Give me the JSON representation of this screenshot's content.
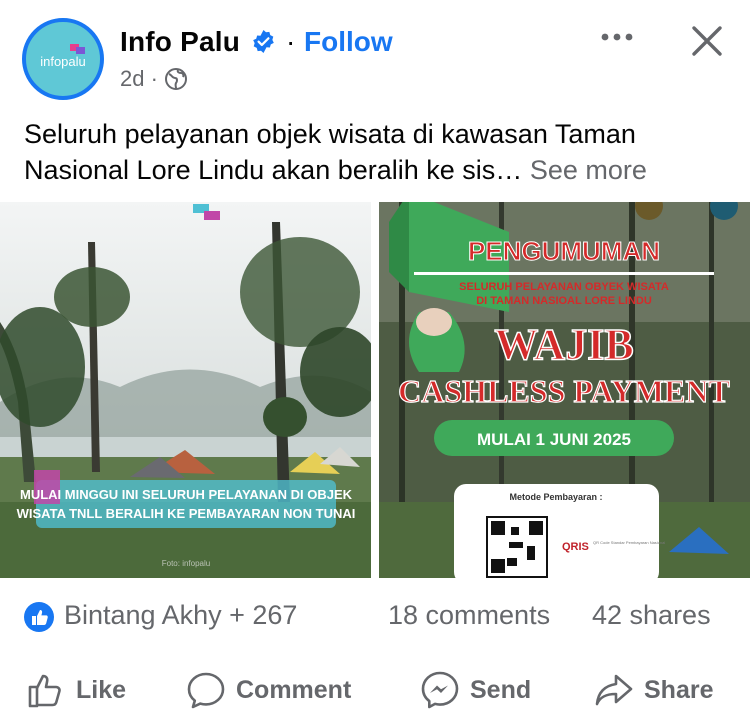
{
  "post": {
    "page_name": "Info Palu",
    "follow_label": "Follow",
    "separator": "·",
    "age": "2d ·",
    "avatar_text": "infopalu",
    "text": "Seluruh pelayanan objek wisata di kawasan Taman Nasional Lore Lindu akan beralih ke sis…",
    "see_more": "See more"
  },
  "photo1": {
    "caption_line1": "MULAI MINGGU INI SELURUH PELAYANAN DI OBJEK",
    "caption_line2": "WISATA TNLL BERALIH KE PEMBAYARAN NON TUNAI",
    "watermark": "Foto: infopalu"
  },
  "photo2": {
    "heading": "PENGUMUMAN",
    "sub_line1": "SELURUH PELAYANAN OBYEK WISATA",
    "sub_line2": "DI TAMAN NASIOAL LORE LINDU",
    "big1": "WAJIB",
    "big2": "CASHLESS PAYMENT",
    "date_banner": "MULAI 1 JUNI 2025",
    "payment_title": "Metode Pembayaran :",
    "qris_label": "QRIS",
    "qris_small": "QR Code Standar Pembayaran Nasional"
  },
  "stats": {
    "reactors": "Bintang Akhy + 267",
    "comments": "18 comments",
    "shares": "42 shares"
  },
  "actions": {
    "like": "Like",
    "comment": "Comment",
    "send": "Send",
    "share": "Share"
  },
  "colors": {
    "facebook_blue": "#1877f2",
    "secondary_text": "#65676b",
    "poster_red": "#d42a2a",
    "poster_green": "#3fa95a"
  }
}
